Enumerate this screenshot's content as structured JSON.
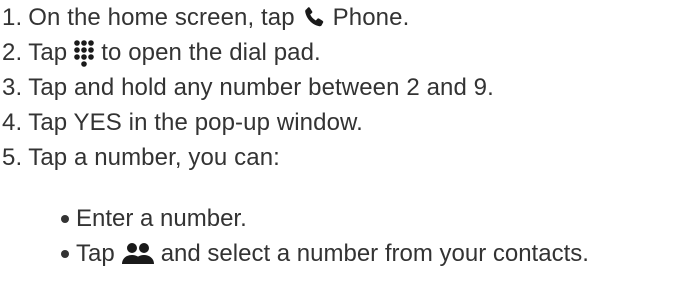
{
  "steps": [
    {
      "number": "1.",
      "before_icon": "On the home screen, tap",
      "icon": "phone-icon",
      "after_icon": "Phone."
    },
    {
      "number": "2.",
      "before_icon": "Tap",
      "icon": "dialpad-icon",
      "after_icon": "to open the dial pad."
    },
    {
      "number": "3.",
      "text": "Tap and hold any number between 2 and 9."
    },
    {
      "number": "4.",
      "text": "Tap YES in the pop-up window."
    },
    {
      "number": "5.",
      "text": "Tap a number, you can:"
    }
  ],
  "bullets": [
    {
      "text": "Enter a number."
    },
    {
      "before_icon": "Tap",
      "icon": "contacts-icon",
      "after_icon": "and select a number from your contacts."
    }
  ],
  "colors": {
    "text": "#333333",
    "icon": "#1a1a1a"
  }
}
